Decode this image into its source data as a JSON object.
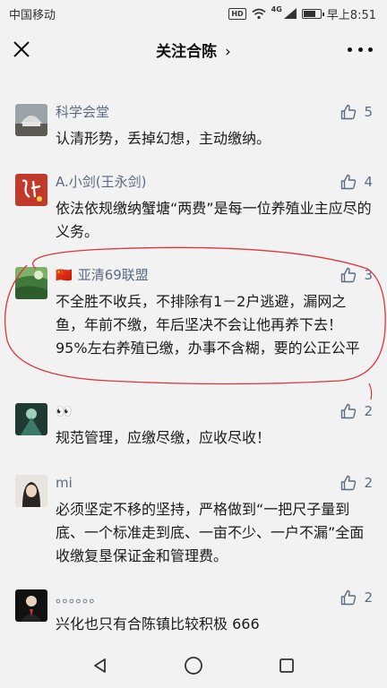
{
  "status": {
    "carrier": "中国移动",
    "hd_badge": "HD",
    "network": "4G",
    "time": "早上8:51",
    "battery_level": 0.8
  },
  "header": {
    "title": "关注合陈",
    "title_chevron": "›"
  },
  "comments": [
    {
      "name": "科学会堂",
      "likes": "5",
      "text": "认清形势，丢掉幻想，主动缴纳。"
    },
    {
      "name": "A.小剑(王永剑)",
      "likes": "4",
      "text": "依法依规缴纳蟹塘“两费”是每一位养殖业主应尽的义务。"
    },
    {
      "flag": "🇨🇳",
      "name": "亚清69联盟",
      "likes": "3",
      "text": "不全胜不收兵，不排除有1－2户逃避，漏网之鱼，年前不缴，年后坚决不会让他再养下去！95%左右养殖已缴，办事不含糊，要的公正公平"
    },
    {
      "name": "👀",
      "likes": "2",
      "text": "规范管理，应缴尽缴，应收尽收！"
    },
    {
      "name": "mi",
      "likes": "2",
      "text": "必须坚定不移的坚持，严格做到“一把尺子量到底、一个标准走到底、一亩不少、一户不漏”全面收缴复垦保证金和管理费。"
    },
    {
      "name": "。。。。。。",
      "likes": "2",
      "text": "兴化也只有合陈镇比较积极 666"
    }
  ],
  "colors": {
    "background": "#f2f2f2",
    "name_color": "#5b6b84",
    "annotation_red": "#d9363e"
  }
}
